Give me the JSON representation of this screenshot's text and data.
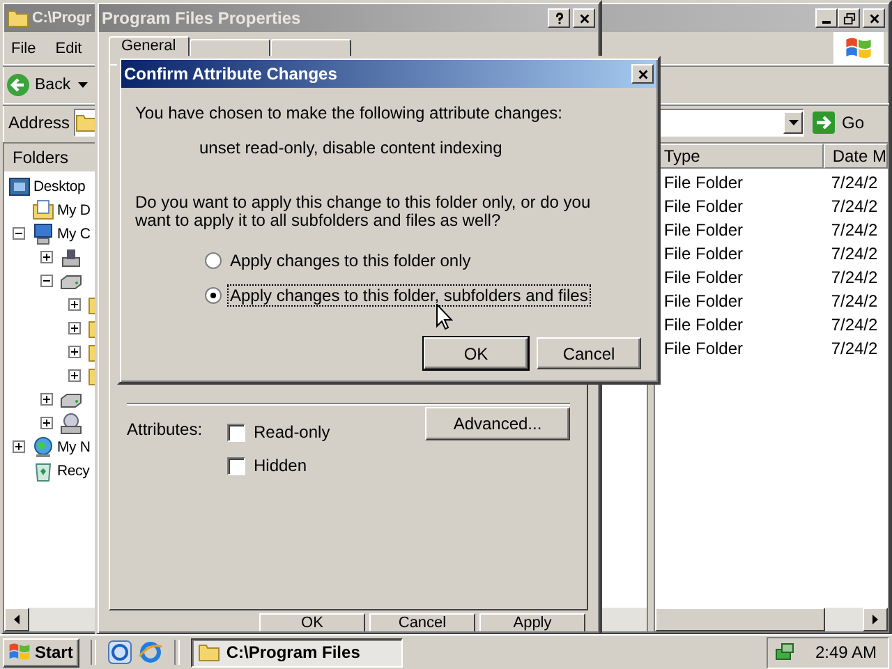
{
  "explorer": {
    "title": "C:\\Progr",
    "menu": [
      "File",
      "Edit"
    ],
    "back_label": "Back",
    "address_label": "Address",
    "go_label": "Go",
    "folders_label": "Folders",
    "tree": [
      {
        "label": "Desktop",
        "kind": "desktop",
        "children": [
          {
            "label": "My D",
            "kind": "documents"
          },
          {
            "label": "My C",
            "kind": "computer",
            "expanded": true,
            "children": [
              {
                "kind": "floppy",
                "expanded": false
              },
              {
                "kind": "drive",
                "expanded": true,
                "children": [
                  {
                    "kind": "folder",
                    "expanded": false
                  },
                  {
                    "kind": "folder",
                    "expanded": false
                  },
                  {
                    "kind": "folder",
                    "expanded": false
                  },
                  {
                    "kind": "folder",
                    "expanded": false
                  }
                ]
              },
              {
                "kind": "drive",
                "expanded": false
              },
              {
                "kind": "cdrom",
                "expanded": false
              }
            ]
          },
          {
            "label": "My N",
            "kind": "network",
            "expanded": false
          },
          {
            "label": "Recy",
            "kind": "recycle"
          }
        ]
      }
    ],
    "columns": [
      "Type",
      "Date M"
    ],
    "rows": [
      {
        "type": "File Folder",
        "date": "7/24/2"
      },
      {
        "type": "File Folder",
        "date": "7/24/2"
      },
      {
        "type": "File Folder",
        "date": "7/24/2"
      },
      {
        "type": "File Folder",
        "date": "7/24/2"
      },
      {
        "type": "File Folder",
        "date": "7/24/2"
      },
      {
        "type": "File Folder",
        "date": "7/24/2"
      },
      {
        "type": "File Folder",
        "date": "7/24/2"
      },
      {
        "type": "File Folder",
        "date": "7/24/2"
      }
    ]
  },
  "properties": {
    "title": "Program Files Properties",
    "tabs": [
      {
        "label": "General",
        "selected": true
      },
      {
        "selected": false
      },
      {
        "selected": false
      }
    ],
    "attributes_label": "Attributes:",
    "checkboxes": [
      {
        "label": "Read-only",
        "checked": false
      },
      {
        "label": "Hidden",
        "checked": false
      }
    ],
    "advanced_button": "Advanced...",
    "buttons": [
      "OK",
      "Cancel",
      "Apply"
    ]
  },
  "dialog": {
    "title": "Confirm Attribute Changes",
    "message": "You have chosen to make the following attribute changes:",
    "changes": "unset read-only, disable content indexing",
    "question": "Do you want to apply this change to this folder only, or do you want to apply it to all subfolders and files as well?",
    "options": [
      {
        "label": "Apply changes to this folder only",
        "selected": false
      },
      {
        "label": "Apply changes to this folder, subfolders and files",
        "selected": true
      }
    ],
    "buttons": [
      "OK",
      "Cancel"
    ]
  },
  "taskbar": {
    "start": "Start",
    "tasks": [
      {
        "label": "C:\\Program Files",
        "selected": true
      }
    ],
    "clock": "2:49 AM"
  }
}
